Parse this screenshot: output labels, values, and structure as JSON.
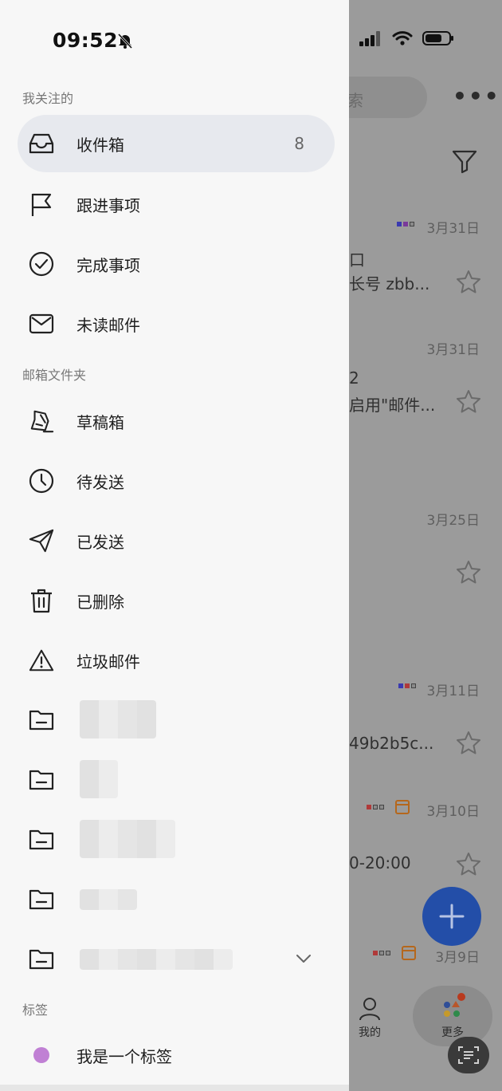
{
  "status": {
    "time": "09:52"
  },
  "drawer": {
    "sections": {
      "following": "我关注的",
      "folders": "邮箱文件夹",
      "tags": "标签"
    },
    "following_items": [
      {
        "label": "收件箱",
        "icon": "inbox-icon",
        "count": "8",
        "active": true
      },
      {
        "label": "跟进事项",
        "icon": "flag-icon"
      },
      {
        "label": "完成事项",
        "icon": "check-circle-icon"
      },
      {
        "label": "未读邮件",
        "icon": "envelope-icon"
      }
    ],
    "folder_items": [
      {
        "label": "草稿箱",
        "icon": "draft-icon"
      },
      {
        "label": "待发送",
        "icon": "clock-icon"
      },
      {
        "label": "已发送",
        "icon": "send-icon"
      },
      {
        "label": "已删除",
        "icon": "trash-icon"
      },
      {
        "label": "垃圾邮件",
        "icon": "warning-icon"
      }
    ],
    "tag_items": [
      {
        "label": "我是一个标签",
        "color": "#c080d4"
      }
    ]
  },
  "background": {
    "search_fragment": "索",
    "mails": [
      {
        "date": "3月31日",
        "line1": "口",
        "line2": "长号 zbb..."
      },
      {
        "date": "3月31日",
        "line1": "2",
        "line2": "启用\"邮件..."
      },
      {
        "date": "3月25日",
        "line1": "",
        "line2": ""
      },
      {
        "date": "3月11日",
        "line1": "",
        "line2": "49b2b5c..."
      },
      {
        "date": "3月10日",
        "line1": "",
        "line2": "0-20:00"
      },
      {
        "date": "3月9日",
        "line1": "",
        "line2": ""
      }
    ],
    "bottom_nav": {
      "mine": "我的",
      "more": "更多"
    }
  },
  "colors": {
    "accent": "#1e5bd8",
    "tag": "#c080d4",
    "active_bg": "#e7e9ee"
  }
}
